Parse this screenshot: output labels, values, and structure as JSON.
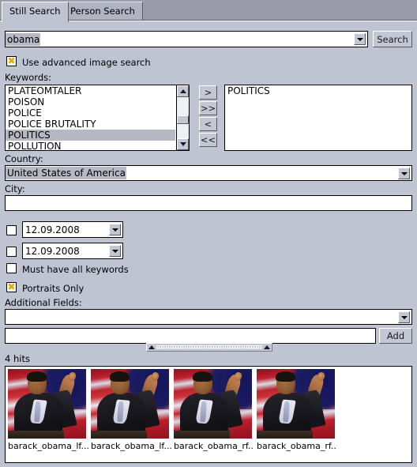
{
  "window": {
    "background": "#bfc4d2"
  },
  "tabs": [
    {
      "label": "Still Search",
      "active": true
    },
    {
      "label": "Person Search",
      "active": false
    }
  ],
  "search": {
    "query_value": "obama",
    "query_placeholder": "",
    "search_button": "Search",
    "dropdown_icon": "chevron-down-icon"
  },
  "advanced": {
    "label": "Use advanced image search",
    "checked": true,
    "check_glyph": "✖"
  },
  "keywords": {
    "label": "Keywords:",
    "available": [
      {
        "text": "PLATEOMTALER",
        "selected": false
      },
      {
        "text": "POISON",
        "selected": false
      },
      {
        "text": "POLICE",
        "selected": false
      },
      {
        "text": "POLICE BRUTALITY",
        "selected": false
      },
      {
        "text": "POLITICS",
        "selected": true
      },
      {
        "text": "POLLUTION",
        "selected": false
      }
    ],
    "selected": [
      {
        "text": "POLITICS"
      }
    ],
    "transfer_buttons": [
      {
        "label": ">",
        "name": "add-keyword-button"
      },
      {
        "label": ">>",
        "name": "add-all-keywords-button"
      },
      {
        "label": "<",
        "name": "remove-keyword-button"
      },
      {
        "label": "<<",
        "name": "remove-all-keywords-button"
      }
    ]
  },
  "country": {
    "label": "Country:",
    "value": "United States of America"
  },
  "city": {
    "label": "City:",
    "value": "",
    "placeholder": ""
  },
  "dates": {
    "from": {
      "value": "12.09.2008",
      "checked": false
    },
    "to": {
      "value": "12.09.2008",
      "checked": false
    }
  },
  "options": {
    "must_have_all_keywords": {
      "label": "Must have all keywords",
      "checked": false
    },
    "portraits_only": {
      "label": "Portraits Only",
      "checked": true
    }
  },
  "additional_fields": {
    "label": "Additional Fields:",
    "select_value": "",
    "input_value": "",
    "add_button": "Add"
  },
  "splitter": {
    "name": "horizontal-splitter",
    "left_caret": "caret-up-icon",
    "right_caret": "caret-up-icon"
  },
  "results": {
    "hits_text": "4 hits",
    "items": [
      {
        "caption": "barack_obama_lf..."
      },
      {
        "caption": "barack_obama_lf..."
      },
      {
        "caption": "barack_obama_rf..."
      },
      {
        "caption": "barack_obama_rf..."
      }
    ]
  },
  "colors": {
    "face": "#bfc4d2",
    "selection": "#b6b9c4",
    "check_mark": "#e3a900",
    "field": "#ffffff",
    "border": "#000000"
  }
}
